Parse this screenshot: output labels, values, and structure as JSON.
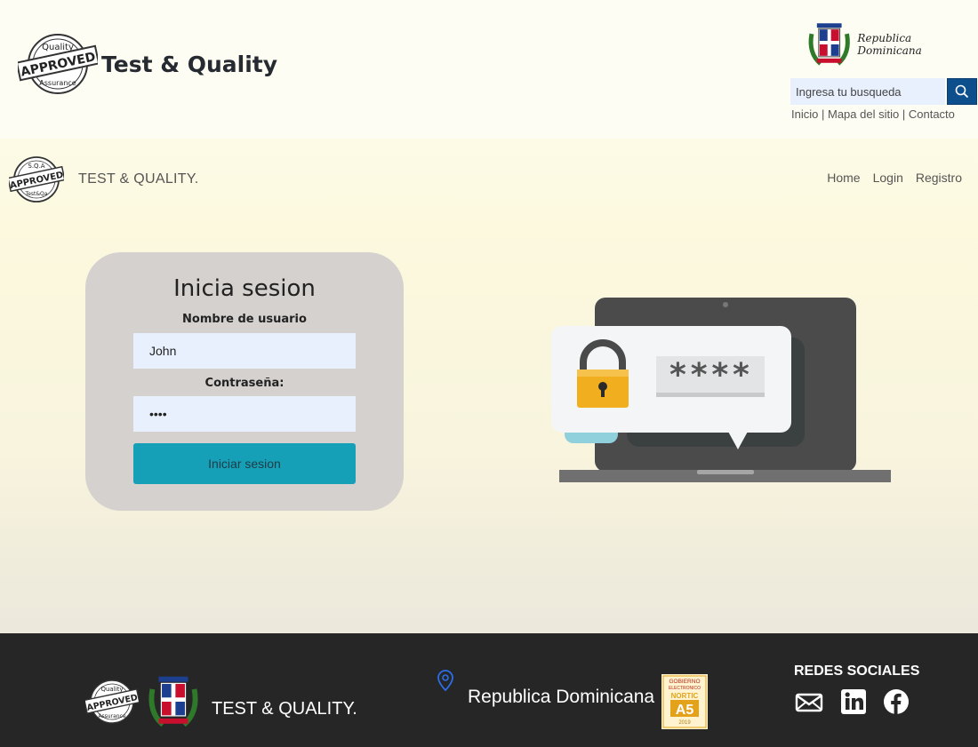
{
  "header": {
    "brand_title": "Test & Quality",
    "logo_stamp_top": "Quality",
    "logo_stamp_mid": "APPROVED",
    "logo_stamp_bottom": "Assurance",
    "rd_label": "Republica Dominicana",
    "search": {
      "placeholder": "Ingresa tu busqueda",
      "icon": "search-icon"
    },
    "links": [
      "Inicio",
      "Mapa del sitio",
      "Contacto"
    ],
    "link_separator": "|"
  },
  "navbar": {
    "brand_text": "TEST & QUALITY.",
    "logo_stamp_top": "S.Q.A",
    "logo_stamp_mid": "APPROVED",
    "logo_stamp_bottom": "Test&Qa",
    "links": [
      "Home",
      "Login",
      "Registro"
    ]
  },
  "login": {
    "title": "Inicia sesion",
    "username_label": "Nombre de usuario",
    "username_value": "John",
    "password_label": "Contraseña:",
    "password_value": "1234",
    "submit_label": "Iniciar sesion"
  },
  "illustration": {
    "masked_text": "****",
    "icons": [
      "laptop-icon",
      "padlock-icon"
    ]
  },
  "footer": {
    "brand_text": "TEST & QUALITY.",
    "location": "Republica Dominicana",
    "location_icon": "map-pin-icon",
    "nortic_label_1": "GOBIERNO",
    "nortic_label_2": "ELECTRONICO",
    "nortic_label_3": "NORTIC",
    "nortic_label_4": "A5",
    "nortic_label_5": "2019",
    "social_title": "REDES SOCIALES",
    "social_icons": [
      "email-icon",
      "linkedin-icon",
      "facebook-icon"
    ]
  },
  "colors": {
    "accent": "#16a0b8",
    "search_button": "#0d4e8d",
    "card_background": "#d5d1ce",
    "footer_background": "#262626",
    "input_background": "#e8effd"
  }
}
